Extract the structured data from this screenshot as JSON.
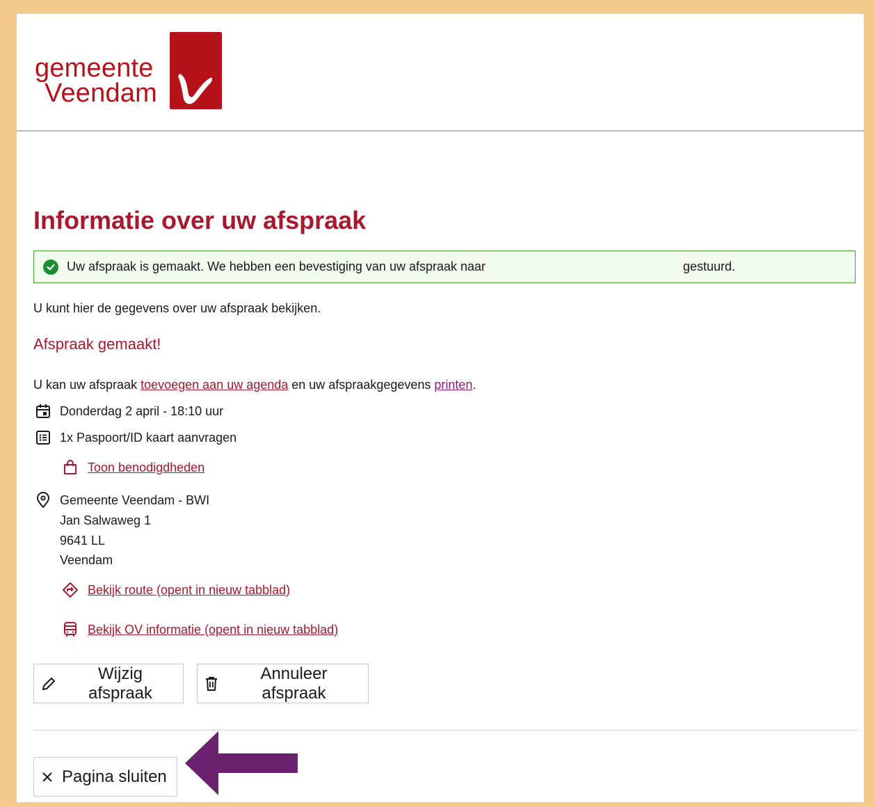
{
  "colors": {
    "brand": "#b5121b",
    "heading": "#a8192e",
    "success": "#1e8b35",
    "border_frame": "#f4c98d",
    "annotation_arrow": "#6a2270"
  },
  "logo": {
    "line1": "gemeente",
    "line2": "Veendam"
  },
  "page_title": "Informatie over uw afspraak",
  "alert": {
    "icon": "check-circle-icon",
    "message": "Uw afspraak is gemaakt. We hebben een bevestiging van uw afspraak naar",
    "message_end": "gestuurd."
  },
  "intro": "U kunt hier de gegevens over uw afspraak bekijken.",
  "section_title": "Afspraak gemaakt!",
  "agenda_line": {
    "prefix": "U kan uw afspraak ",
    "agenda_link": "toevoegen aan uw agenda",
    "middle": " en uw afspraakgegevens ",
    "print_link": "printen",
    "suffix": "."
  },
  "appointment": {
    "date_time": "Donderdag 2 april - 18:10 uur",
    "product": "1x Paspoort/ID kaart aanvragen",
    "requirements_link": "Toon benodigdheden",
    "location": {
      "name": "Gemeente Veendam - BWI",
      "street": "Jan Salwaweg 1",
      "postcode": "9641 LL",
      "city": "Veendam"
    },
    "route_link": "Bekijk route (opent in nieuw tabblad)",
    "ov_link": "Bekijk OV informatie (opent in nieuw tabblad)"
  },
  "buttons": {
    "change": "Wijzig afspraak",
    "cancel": "Annuleer afspraak",
    "close": "Pagina sluiten"
  }
}
